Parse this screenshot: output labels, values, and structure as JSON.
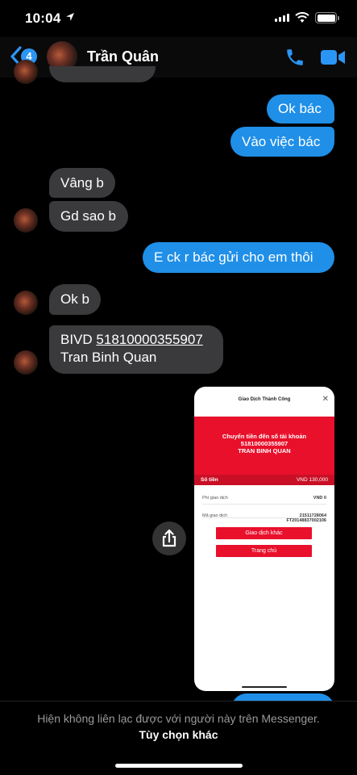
{
  "status_bar": {
    "time": "10:04"
  },
  "header": {
    "unread_count": "4",
    "contact_name": "Trần Quân"
  },
  "messages": [
    {
      "dir": "out",
      "text": "Ok bác"
    },
    {
      "dir": "out",
      "text": "Vào việc bác"
    },
    {
      "dir": "in",
      "text": "Vâng b"
    },
    {
      "dir": "in",
      "text": "Gd sao b"
    },
    {
      "dir": "out",
      "text": "E ck r bác gửi cho em thôi"
    },
    {
      "dir": "in",
      "text": "Ok b"
    },
    {
      "dir": "in",
      "line1_prefix": "BIVD ",
      "line1_account": "51810000355907",
      "line2": "Tran Binh Quan"
    }
  ],
  "receipt": {
    "title": "Giao Dịch Thành Công",
    "headline": "Chuyển tiền đến số tài khoản",
    "account": "51810000355907",
    "recipient": "TRAN BINH QUAN",
    "amount_label": "Số tiền",
    "amount_value": "VND  130,000",
    "fee_label": "Phí giao dịch",
    "fee_value": "VND 0",
    "txn_label": "Mã giao dịch",
    "txn_value_1": "21511728064",
    "txn_value_2": "FT20148837002106",
    "btn_other": "Giao dịch khác",
    "btn_home": "Trang chủ"
  },
  "footer": {
    "message": "Hiện không liên lạc được với người này trên Messenger.",
    "link": "Tùy chọn khác"
  },
  "colors": {
    "outgoing": "#1f8fe8",
    "incoming": "#3a3a3c",
    "receipt_red": "#e8102b"
  }
}
